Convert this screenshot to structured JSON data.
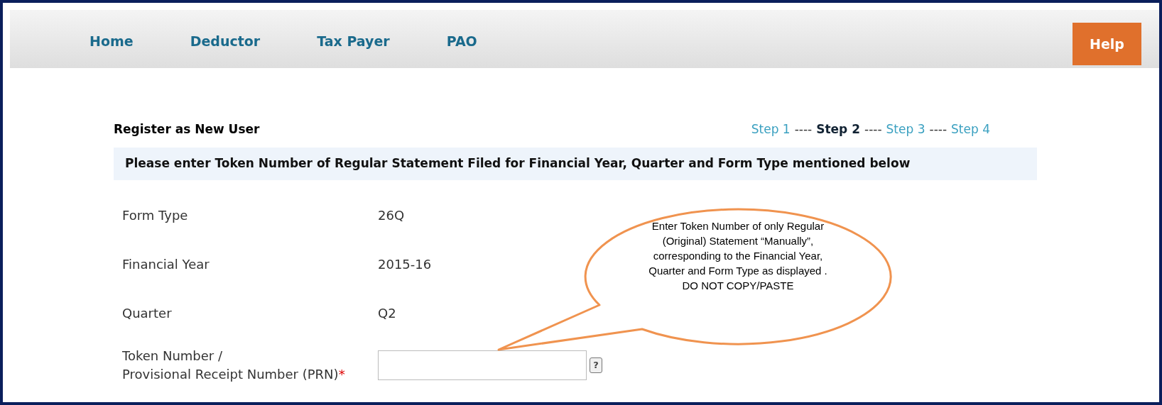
{
  "nav": {
    "items": [
      {
        "label": "Home"
      },
      {
        "label": "Deductor"
      },
      {
        "label": "Tax Payer"
      },
      {
        "label": "PAO"
      }
    ],
    "help_button": "Help"
  },
  "page_title": "Register as New User",
  "steps": {
    "items": [
      {
        "label": "Step 1",
        "selected": false
      },
      {
        "label": "Step 2",
        "selected": true
      },
      {
        "label": "Step 3",
        "selected": false
      },
      {
        "label": "Step 4",
        "selected": false
      }
    ],
    "separators": [
      "----",
      "----",
      "----"
    ]
  },
  "instruction": "Please enter Token Number of Regular Statement Filed for Financial Year, Quarter and Form Type mentioned below",
  "fields": [
    {
      "label": "Form Type",
      "value": "26Q"
    },
    {
      "label": "Financial Year",
      "value": "2015-16"
    },
    {
      "label": "Quarter",
      "value": "Q2"
    }
  ],
  "token_field": {
    "label": "Token Number /\nProvisional Receipt Number (PRN)",
    "required_mark": "*",
    "help_icon": "?"
  },
  "callout": "Enter Token Number of only Regular (Original) Statement “Manually”, corresponding to the Financial Year, Quarter and Form Type as displayed . DO NOT COPY/PASTE"
}
